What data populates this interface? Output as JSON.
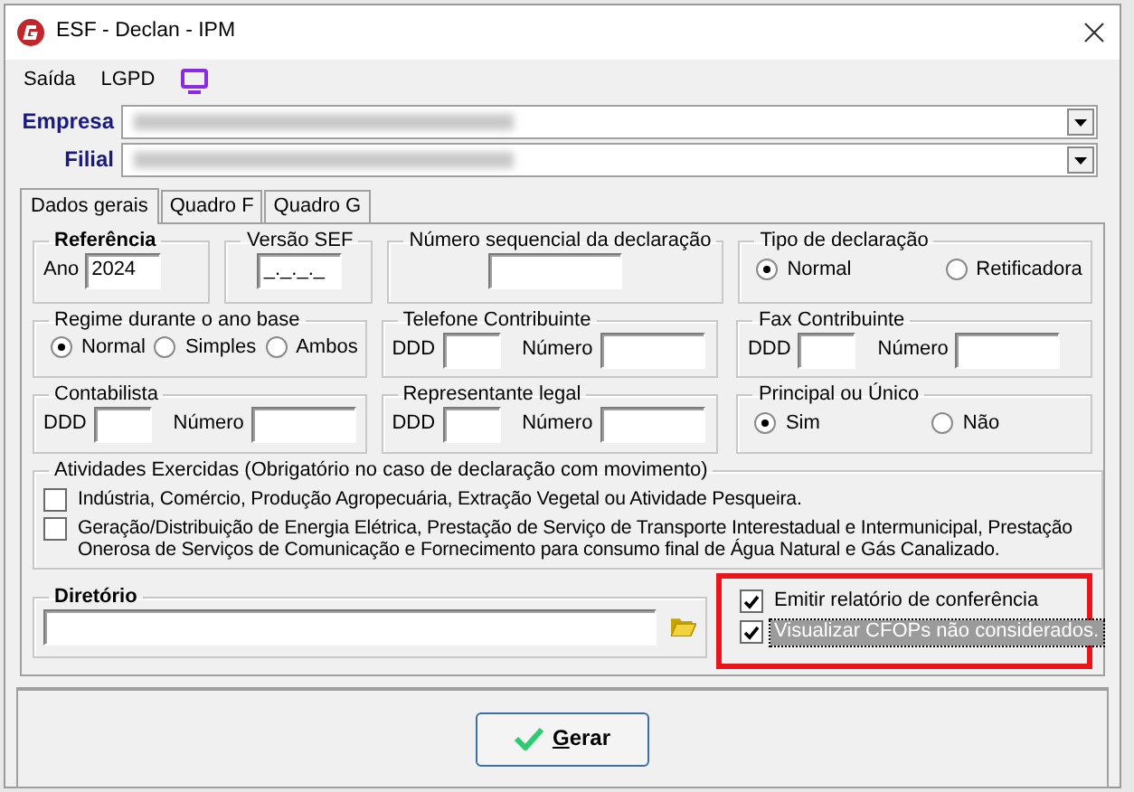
{
  "window": {
    "title": "ESF - Declan - IPM"
  },
  "menu": [
    {
      "label": "Saída"
    },
    {
      "label": "LGPD"
    }
  ],
  "selectors": [
    {
      "label": "Empresa"
    },
    {
      "label": "Filial"
    }
  ],
  "tabs": [
    {
      "label": "Dados gerais",
      "selected": true
    },
    {
      "label": "Quadro F",
      "selected": false
    },
    {
      "label": "Quadro G",
      "selected": false
    }
  ],
  "referencia": {
    "title": "Referência",
    "label": "Ano",
    "value": "2024"
  },
  "versao_sef": {
    "title": "Versão SEF",
    "value": "_._._._"
  },
  "numero_sequencial": {
    "title": "Número sequencial da declaração"
  },
  "tipo_declaracao": {
    "title": "Tipo de declaração",
    "options": [
      {
        "label": "Normal",
        "selected": true
      },
      {
        "label": "Retificadora",
        "selected": false
      }
    ]
  },
  "regime": {
    "title": "Regime durante o ano base",
    "options": [
      {
        "label": "Normal",
        "selected": true
      },
      {
        "label": "Simples",
        "selected": false
      },
      {
        "label": "Ambos",
        "selected": false
      }
    ]
  },
  "telefone": {
    "title": "Telefone Contribuinte",
    "ddd_label": "DDD",
    "numero_label": "Número"
  },
  "fax": {
    "title": "Fax Contribuinte",
    "ddd_label": "DDD",
    "numero_label": "Número"
  },
  "contabilista": {
    "title": "Contabilista",
    "ddd_label": "DDD",
    "numero_label": "Número"
  },
  "representante": {
    "title": "Representante legal",
    "ddd_label": "DDD",
    "numero_label": "Número"
  },
  "principal": {
    "title": "Principal ou Único",
    "options": [
      {
        "label": "Sim",
        "selected": true
      },
      {
        "label": "Não",
        "selected": false
      }
    ]
  },
  "atividades": {
    "title": "Atividades Exercidas (Obrigatório no caso de declaração com movimento)",
    "items": [
      {
        "label": "Indústria, Comércio, Produção Agropecuária, Extração Vegetal ou Atividade Pesqueira.",
        "checked": false
      },
      {
        "label": "Geração/Distribuição de Energia Elétrica, Prestação de Serviço de Transporte Interestadual e Intermunicipal, Prestação Onerosa de Serviços de Comunicação e Fornecimento para consumo final de Água Natural e Gás Canalizado.",
        "checked": false
      }
    ]
  },
  "diretorio": {
    "title": "Diretório"
  },
  "options": [
    {
      "label": "Emitir relatório de conferência",
      "checked": true,
      "focused": false
    },
    {
      "label": "Visualizar CFOPs não considerados.",
      "checked": true,
      "focused": true
    }
  ],
  "button": {
    "label": "Gerar",
    "underline_first": true
  }
}
